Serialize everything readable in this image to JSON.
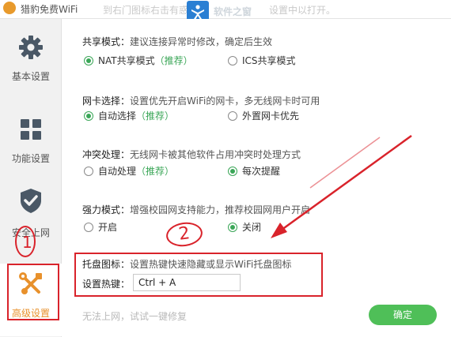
{
  "window": {
    "title": "猎豹免费WiFi"
  },
  "ghost_texts": [
    "到右门图标右击有惑助窗",
    "设置中以打开。"
  ],
  "watermark_title": "软件之窗",
  "sidebar": {
    "items": [
      {
        "label": "基本设置",
        "icon": "gear-icon"
      },
      {
        "label": "功能设置",
        "icon": "grid-icon"
      },
      {
        "label": "安全上网",
        "icon": "shield-check-icon"
      },
      {
        "label": "高级设置",
        "icon": "tools-icon",
        "active": true
      }
    ]
  },
  "annotations": {
    "one": "1",
    "two": "2"
  },
  "sections": {
    "share": {
      "title": "共享模式：",
      "desc": "建议连接异常时修改，确定后生效",
      "options": [
        {
          "label": "NAT共享模式",
          "rec": "（推荐）",
          "checked": true
        },
        {
          "label": "ICS共享模式",
          "rec": "",
          "checked": false
        }
      ]
    },
    "nic": {
      "title": "网卡选择：",
      "desc": "设置优先开启WiFi的网卡，多无线网卡时可用",
      "options": [
        {
          "label": "自动选择",
          "rec": "（推荐）",
          "checked": true
        },
        {
          "label": "外置网卡优先",
          "rec": "",
          "checked": false
        }
      ]
    },
    "conflict": {
      "title": "冲突处理：",
      "desc": "无线网卡被其他软件占用冲突时处理方式",
      "options": [
        {
          "label": "自动处理",
          "rec": "（推荐）",
          "checked": false
        },
        {
          "label": "每次提醒",
          "rec": "",
          "checked": true
        }
      ]
    },
    "force": {
      "title": "强力模式：",
      "desc": "增强校园网支持能力，推荐校园网用户开启",
      "options": [
        {
          "label": "开启",
          "rec": "",
          "checked": false
        },
        {
          "label": "关闭",
          "rec": "",
          "checked": true
        }
      ]
    },
    "tray": {
      "title": "托盘图标：",
      "desc": "设置热键快速隐藏或显示WiFi托盘图标",
      "hotkey_label": "设置热键：",
      "hotkey_value": "Ctrl + A"
    }
  },
  "footer": {
    "hint": "无法上网，试试一键修复",
    "save_label": "确定"
  },
  "colors": {
    "accent_green": "#3aa657",
    "annotation_red": "#d9232b",
    "active_orange": "#e8912c"
  }
}
